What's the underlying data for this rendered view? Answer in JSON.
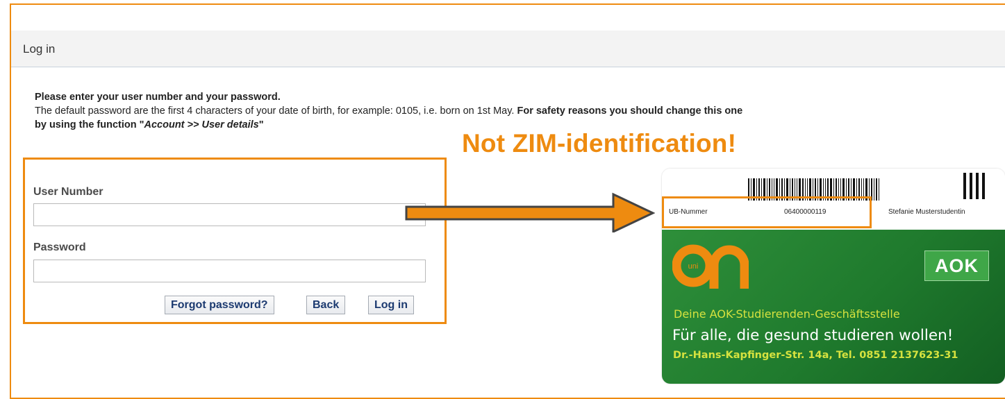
{
  "header": {
    "title": "Log in"
  },
  "intro": {
    "line1": "Please enter your user number and your password.",
    "line2_normal": "The default password are the first 4 characters of your date of birth, for example: 0105, i.e. born on 1st May.",
    "line2_bold": "For safety reasons you should change this one",
    "line3_prefix": "by using the function \"",
    "line3_italic": "Account >> User details",
    "line3_suffix": "\""
  },
  "note": "Not ZIM-identification!",
  "form": {
    "user_number_label": "User Number",
    "user_number_value": "",
    "password_label": "Password",
    "password_value": "",
    "forgot_label": "Forgot password?",
    "back_label": "Back",
    "login_label": "Log in"
  },
  "card": {
    "ub_label": "UB-Nummer",
    "ub_number": "06400000119",
    "holder_name": "Stefanie Musterstudentin",
    "uni_logo_small": "uni",
    "uni_logo_text": "on",
    "aok_logo": "AOK",
    "line1": "Deine AOK-Studierenden-Geschäftsstelle",
    "line2": "Für alle, die gesund studieren wollen!",
    "line3": "Dr.-Hans-Kapfinger-Str. 14a, Tel. 0851 2137623-31"
  },
  "colors": {
    "accent_orange": "#ee8b10",
    "card_green": "#1f7a2d",
    "card_yellow_text": "#d6e23f",
    "button_text": "#1c3a70"
  }
}
